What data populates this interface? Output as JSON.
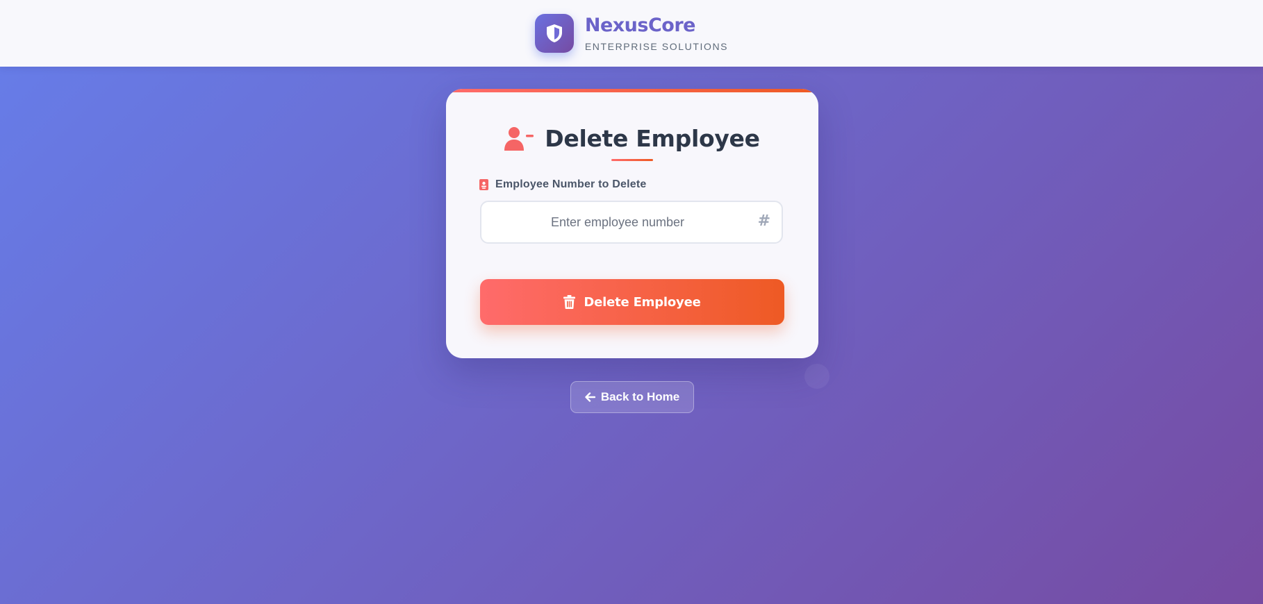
{
  "header": {
    "brand_name": "NexusCore",
    "tagline": "ENTERPRISE SOLUTIONS",
    "logo_icon": "shield-icon"
  },
  "form": {
    "title": "Delete Employee",
    "title_icon": "user-minus-icon",
    "field_label": "Employee Number to Delete",
    "field_label_icon": "id-badge-icon",
    "input_placeholder": "Enter employee number",
    "input_value": "",
    "input_icon": "hash-icon",
    "submit_label": "Delete Employee",
    "submit_icon": "trash-icon"
  },
  "navigation": {
    "back_label": "Back to Home",
    "back_icon": "arrow-left-icon"
  },
  "colors": {
    "background_start": "#667eea",
    "background_end": "#764ba2",
    "accent_start": "#ff6b6b",
    "accent_end": "#ee5a24",
    "title_text": "#2d3748",
    "brand_text": "#6b63c9"
  }
}
